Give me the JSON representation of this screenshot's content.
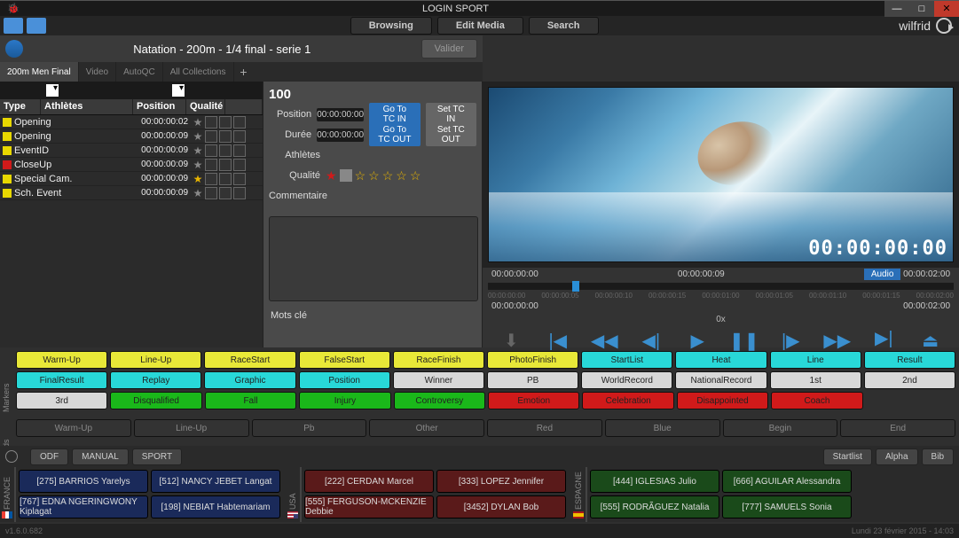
{
  "app": {
    "title": "LOGIN SPORT"
  },
  "topnav": {
    "browsing": "Browsing",
    "editmedia": "Edit Media",
    "search": "Search"
  },
  "user": {
    "name": "wilfrid"
  },
  "event": {
    "title": "Natation - 200m - 1/4 final - serie 1",
    "valider": "Valider"
  },
  "lefttabs": [
    "200m Men Final",
    "Video",
    "AutoQC",
    "All Collections"
  ],
  "tablehead": {
    "type": "Type",
    "athletes": "Athlètes",
    "position": "Position",
    "qualite": "Qualité"
  },
  "rows": [
    {
      "color": "y",
      "name": "Opening",
      "tc": "00:00:00:02",
      "star": ""
    },
    {
      "color": "y",
      "name": "Opening",
      "tc": "00:00:00:09",
      "star": ""
    },
    {
      "color": "y",
      "name": "EventID",
      "tc": "00:00:00:09",
      "star": ""
    },
    {
      "color": "r",
      "name": "CloseUp",
      "tc": "00:00:00:09",
      "star": ""
    },
    {
      "color": "y",
      "name": "Special Cam.",
      "tc": "00:00:00:09",
      "star": "gold"
    },
    {
      "color": "y",
      "name": "Sch. Event",
      "tc": "00:00:00:09",
      "star": ""
    }
  ],
  "mid": {
    "id": "100",
    "position_lbl": "Position",
    "duree_lbl": "Durée",
    "athletes_lbl": "Athlètes",
    "qualite_lbl": "Qualité",
    "comment_lbl": "Commentaire",
    "mots_lbl": "Mots clé",
    "pos_tc": "00:00:00:00",
    "dur_tc": "00:00:00:00",
    "goto_in": "Go To TC IN",
    "goto_out": "Go To TC OUT",
    "set_in": "Set TC IN",
    "set_out": "Set TC OUT"
  },
  "player": {
    "bigtc": "00:00:00:00",
    "tc_start": "00:00:00:00",
    "tc_cur": "00:00:00:09",
    "tc_end": "00:00:02:00",
    "audio": "Audio",
    "speed": "0x",
    "ticks": [
      "00:00:00:00",
      "00:00:00:05",
      "00:00:00:10",
      "00:00:00:15",
      "00:00:01:00",
      "00:00:01:05",
      "00:00:01:10",
      "00:00:01:15",
      "00:00:02:00"
    ],
    "buttons": [
      "LOAD",
      "GOTO TC IN",
      "REWIND",
      "STEP BACK",
      "PLAY",
      "PAUSE",
      "STEP UP",
      "FORWARD",
      "GOTO TC OUT",
      "EJECT"
    ]
  },
  "markers_vlabel": "Markers",
  "markers": [
    [
      {
        "t": "Warm-Up",
        "c": "yellow"
      },
      {
        "t": "Line-Up",
        "c": "yellow"
      },
      {
        "t": "RaceStart",
        "c": "yellow"
      },
      {
        "t": "FalseStart",
        "c": "yellow"
      },
      {
        "t": "RaceFinish",
        "c": "yellow"
      },
      {
        "t": "PhotoFinish",
        "c": "yellow"
      },
      {
        "t": "StartList",
        "c": "cyan"
      },
      {
        "t": "Heat",
        "c": "cyan"
      },
      {
        "t": "Line",
        "c": "cyan"
      },
      {
        "t": "Result",
        "c": "cyan"
      }
    ],
    [
      {
        "t": "FinalResult",
        "c": "cyan"
      },
      {
        "t": "Replay",
        "c": "cyan"
      },
      {
        "t": "Graphic",
        "c": "cyan"
      },
      {
        "t": "Position",
        "c": "cyan"
      },
      {
        "t": "Winner",
        "c": "lgray"
      },
      {
        "t": "PB",
        "c": "lgray"
      },
      {
        "t": "WorldRecord",
        "c": "lgray"
      },
      {
        "t": "NationalRecord",
        "c": "lgray"
      },
      {
        "t": "1st",
        "c": "lgray"
      },
      {
        "t": "2nd",
        "c": "lgray"
      }
    ],
    [
      {
        "t": "3rd",
        "c": "lgray"
      },
      {
        "t": "Disqualified",
        "c": "green"
      },
      {
        "t": "Fall",
        "c": "green"
      },
      {
        "t": "Injury",
        "c": "green"
      },
      {
        "t": "Controversy",
        "c": "green"
      },
      {
        "t": "Emotion",
        "c": "red"
      },
      {
        "t": "Celebration",
        "c": "red"
      },
      {
        "t": "Disappointed",
        "c": "red"
      },
      {
        "t": "Coach",
        "c": "red"
      },
      {
        "t": "",
        "c": ""
      }
    ]
  ],
  "keywords_vlabel": "Keywords",
  "keywords": [
    "Warm-Up",
    "Line-Up",
    "Pb",
    "Other",
    "Red",
    "Blue",
    "Begin",
    "End"
  ],
  "bottom": {
    "sources": [
      "ODF",
      "MANUAL",
      "SPORT"
    ],
    "rightbtns": [
      "Startlist",
      "Alpha",
      "Bib"
    ],
    "countries": [
      {
        "flag": "fr",
        "name": "FRANCE",
        "athletes": [
          [
            "[275] BARRIOS Yarelys",
            "[512] NANCY JEBET Langat"
          ],
          [
            "[767] EDNA NGERINGWONY Kiplagat",
            "[198] NEBIAT Habtemariam"
          ]
        ],
        "color": "navy"
      },
      {
        "flag": "us",
        "name": "USA",
        "athletes": [
          [
            "[222] CERDAN Marcel",
            "[333] LOPEZ Jennifer"
          ],
          [
            "[555] FERGUSON-MCKENZIE Debbie",
            "[3452] DYLAN Bob"
          ]
        ],
        "color": "dred"
      },
      {
        "flag": "es",
        "name": "ESPAGNE",
        "athletes": [
          [
            "[444] IGLESIAS Julio",
            "[666] AGUILAR Alessandra"
          ],
          [
            "[555] RODRÃGUEZ Natalia",
            "[777] SAMUELS Sonia"
          ]
        ],
        "color": "dgrn"
      }
    ]
  },
  "status": {
    "version": "v1.6.0.682",
    "date": "Lundi 23 février 2015 - 14:03"
  }
}
